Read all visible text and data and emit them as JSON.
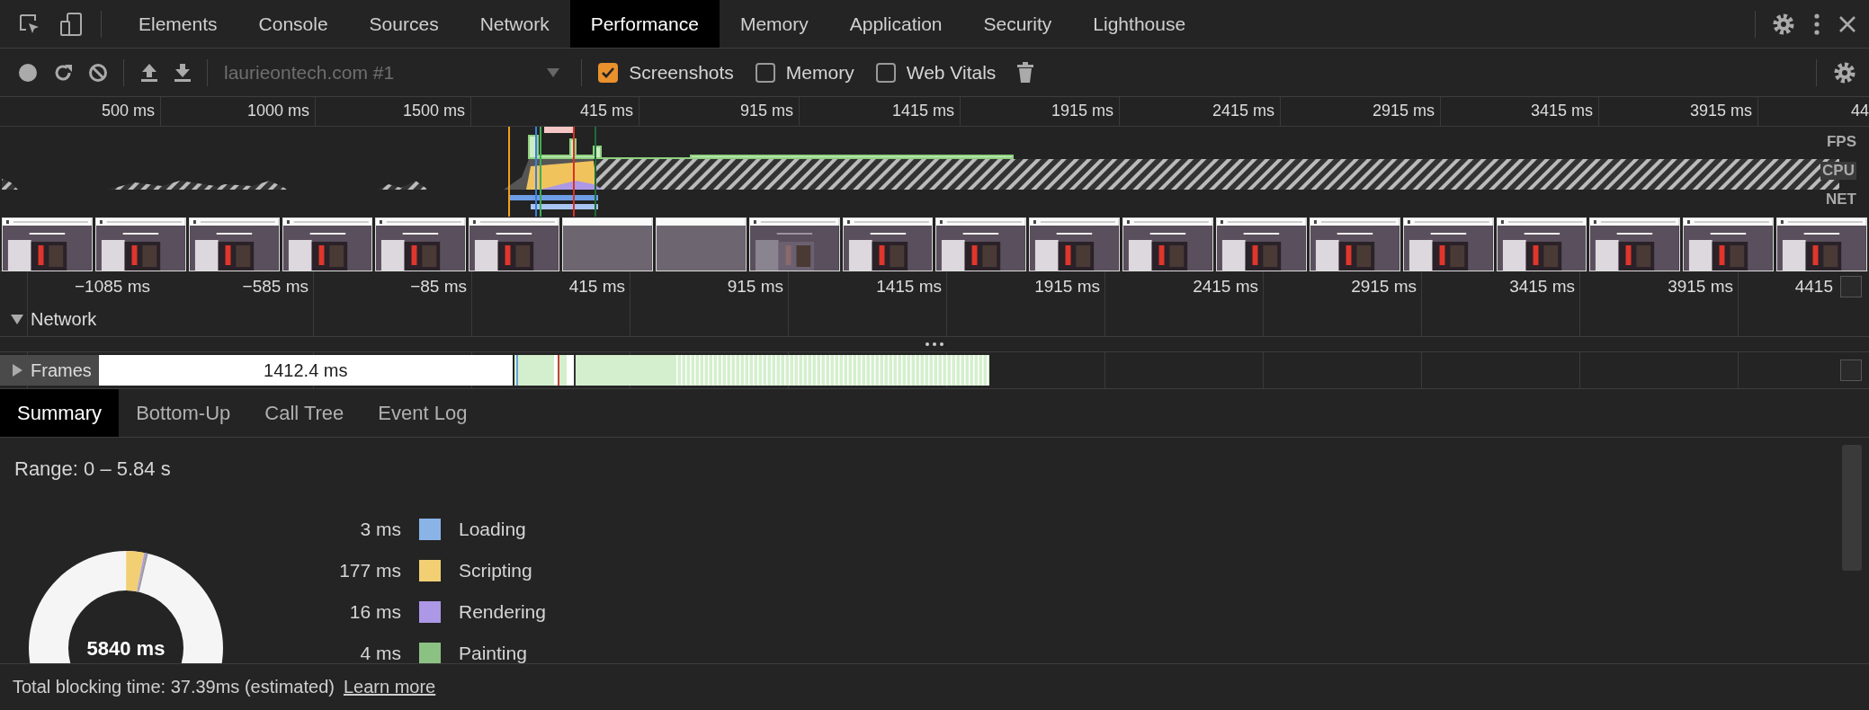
{
  "tabs": [
    {
      "label": "Elements",
      "selected": false
    },
    {
      "label": "Console",
      "selected": false
    },
    {
      "label": "Sources",
      "selected": false
    },
    {
      "label": "Network",
      "selected": false
    },
    {
      "label": "Performance",
      "selected": true
    },
    {
      "label": "Memory",
      "selected": false
    },
    {
      "label": "Application",
      "selected": false
    },
    {
      "label": "Security",
      "selected": false
    },
    {
      "label": "Lighthouse",
      "selected": false
    }
  ],
  "toolbar": {
    "recording_select": {
      "value": "laurieontech.com #1",
      "disabled": true
    },
    "options": [
      {
        "label": "Screenshots",
        "checked": true
      },
      {
        "label": "Memory",
        "checked": false
      },
      {
        "label": "Web Vitals",
        "checked": false
      }
    ]
  },
  "overview": {
    "ruler": [
      "500 ms",
      "1000 ms",
      "1500 ms",
      "415 ms",
      "915 ms",
      "1415 ms",
      "1915 ms",
      "2415 ms",
      "2915 ms",
      "3415 ms",
      "3915 ms",
      "44"
    ],
    "lanes": [
      "FPS",
      "CPU",
      "NET"
    ],
    "screenshots": [
      {
        "kind": "picture"
      },
      {
        "kind": "picture"
      },
      {
        "kind": "picture"
      },
      {
        "kind": "picture"
      },
      {
        "kind": "picture"
      },
      {
        "kind": "picture"
      },
      {
        "kind": "picture"
      },
      {
        "kind": "picture"
      },
      {
        "kind": "picture"
      },
      {
        "kind": "picture"
      },
      {
        "kind": "picture"
      },
      {
        "kind": "picture"
      },
      {
        "kind": "picture"
      },
      {
        "kind": "picture"
      },
      {
        "kind": "picture"
      },
      {
        "kind": "picture"
      },
      {
        "kind": "picture"
      },
      {
        "kind": "picture"
      },
      {
        "kind": "picture"
      },
      {
        "kind": "picture"
      }
    ]
  },
  "timeline": {
    "ruler": [
      "−1085 ms",
      "−585 ms",
      "−85 ms",
      "415 ms",
      "915 ms",
      "1415 ms",
      "1915 ms",
      "2415 ms",
      "2915 ms",
      "3415 ms",
      "3915 ms",
      "4415"
    ],
    "tracks": [
      {
        "label": "Network",
        "expanded": true
      },
      {
        "label": "Frames",
        "expanded": false,
        "frame_duration": "1412.4 ms"
      }
    ]
  },
  "details": {
    "tabs": [
      {
        "label": "Summary",
        "selected": true
      },
      {
        "label": "Bottom-Up",
        "selected": false
      },
      {
        "label": "Call Tree",
        "selected": false
      },
      {
        "label": "Event Log",
        "selected": false
      }
    ],
    "range": "Range: 0 – 5.84 s",
    "total": "5840 ms",
    "legend": [
      {
        "value": "3 ms",
        "label": "Loading",
        "color": "#8ab4e8"
      },
      {
        "value": "177 ms",
        "label": "Scripting",
        "color": "#f2cf73"
      },
      {
        "value": "16 ms",
        "label": "Rendering",
        "color": "#ac98e6"
      },
      {
        "value": "4 ms",
        "label": "Painting",
        "color": "#8cc184"
      }
    ]
  },
  "status_bar": {
    "text": "Total blocking time: 37.39ms (estimated)",
    "link": "Learn more"
  }
}
